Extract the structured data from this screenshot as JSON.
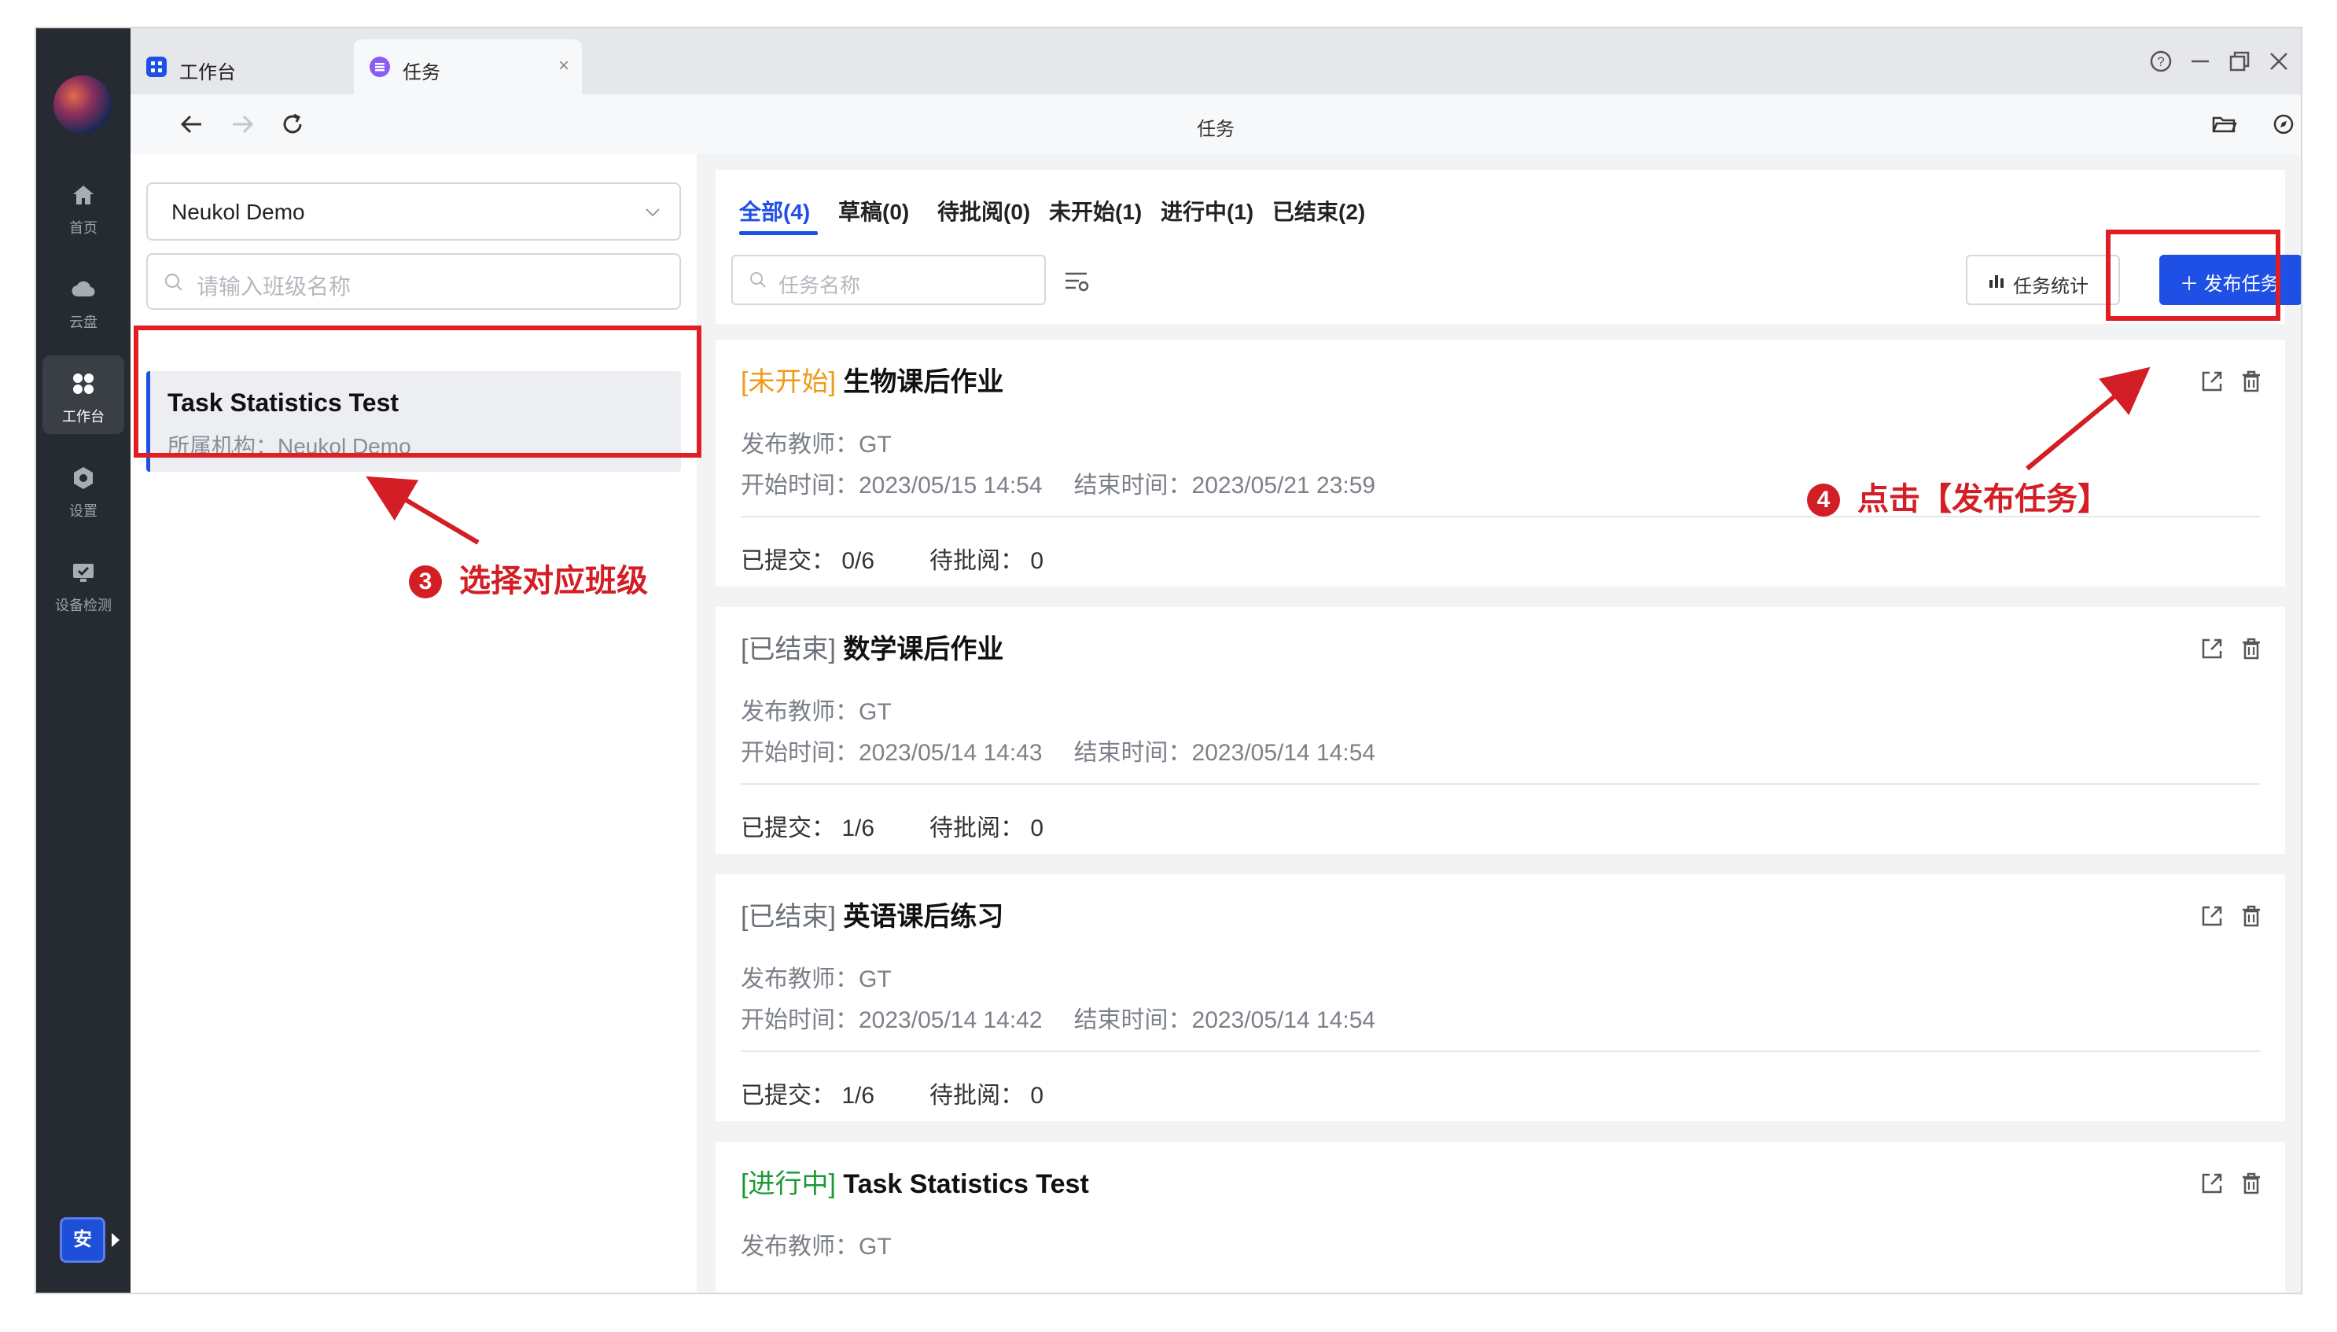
{
  "tabs": [
    {
      "label": "工作台",
      "icon": "grid-icon",
      "color": "#1e50e6"
    },
    {
      "label": "任务",
      "icon": "list-icon",
      "color": "#8b5cf6",
      "close": "×"
    }
  ],
  "nav": {
    "title": "任务"
  },
  "rail": {
    "items": [
      {
        "label": "首页",
        "icon": "home-icon"
      },
      {
        "label": "云盘",
        "icon": "cloud-icon"
      },
      {
        "label": "工作台",
        "icon": "apps-icon"
      },
      {
        "label": "设置",
        "icon": "settings-icon"
      },
      {
        "label": "设备检测",
        "icon": "device-check-icon"
      }
    ],
    "badge": "安"
  },
  "left": {
    "org": "Neukol Demo",
    "search_placeholder": "请输入班级名称",
    "class_name": "Task Statistics Test",
    "class_org_label": "所属机构：",
    "class_org": "Neukol Demo"
  },
  "filters": [
    "全部(4)",
    "草稿(0)",
    "待批阅(0)",
    "未开始(1)",
    "进行中(1)",
    "已结束(2)"
  ],
  "toolbar": {
    "search_placeholder": "任务名称",
    "stats_label": "任务统计",
    "publish_label": "＋ 发布任务"
  },
  "tasks": [
    {
      "status": "[未开始]",
      "status_type": "pending",
      "name": "生物课后作业",
      "teacher": "发布教师：GT",
      "start": "开始时间：2023/05/15 14:54",
      "end": "结束时间：2023/05/21 23:59",
      "submitted": "已提交： 0/6",
      "to_review": "待批阅： 0"
    },
    {
      "status": "[已结束]",
      "status_type": "ended",
      "name": "数学课后作业",
      "teacher": "发布教师：GT",
      "start": "开始时间：2023/05/14 14:43",
      "end": "结束时间：2023/05/14 14:54",
      "submitted": "已提交： 1/6",
      "to_review": "待批阅： 0"
    },
    {
      "status": "[已结束]",
      "status_type": "ended",
      "name": "英语课后练习",
      "teacher": "发布教师：GT",
      "start": "开始时间：2023/05/14 14:42",
      "end": "结束时间：2023/05/14 14:54",
      "submitted": "已提交： 1/6",
      "to_review": "待批阅： 0"
    },
    {
      "status": "[进行中]",
      "status_type": "progress",
      "name": "Task Statistics Test",
      "teacher": "发布教师：GT"
    }
  ],
  "annotations": {
    "step3": {
      "num": "3",
      "text": "选择对应班级"
    },
    "step4": {
      "num": "4",
      "text": "点击【发布任务】"
    }
  },
  "colors": {
    "accent": "#1e50e6",
    "annotation": "#e01e24",
    "pending": "#f09a1a",
    "progress": "#1a9a36"
  }
}
